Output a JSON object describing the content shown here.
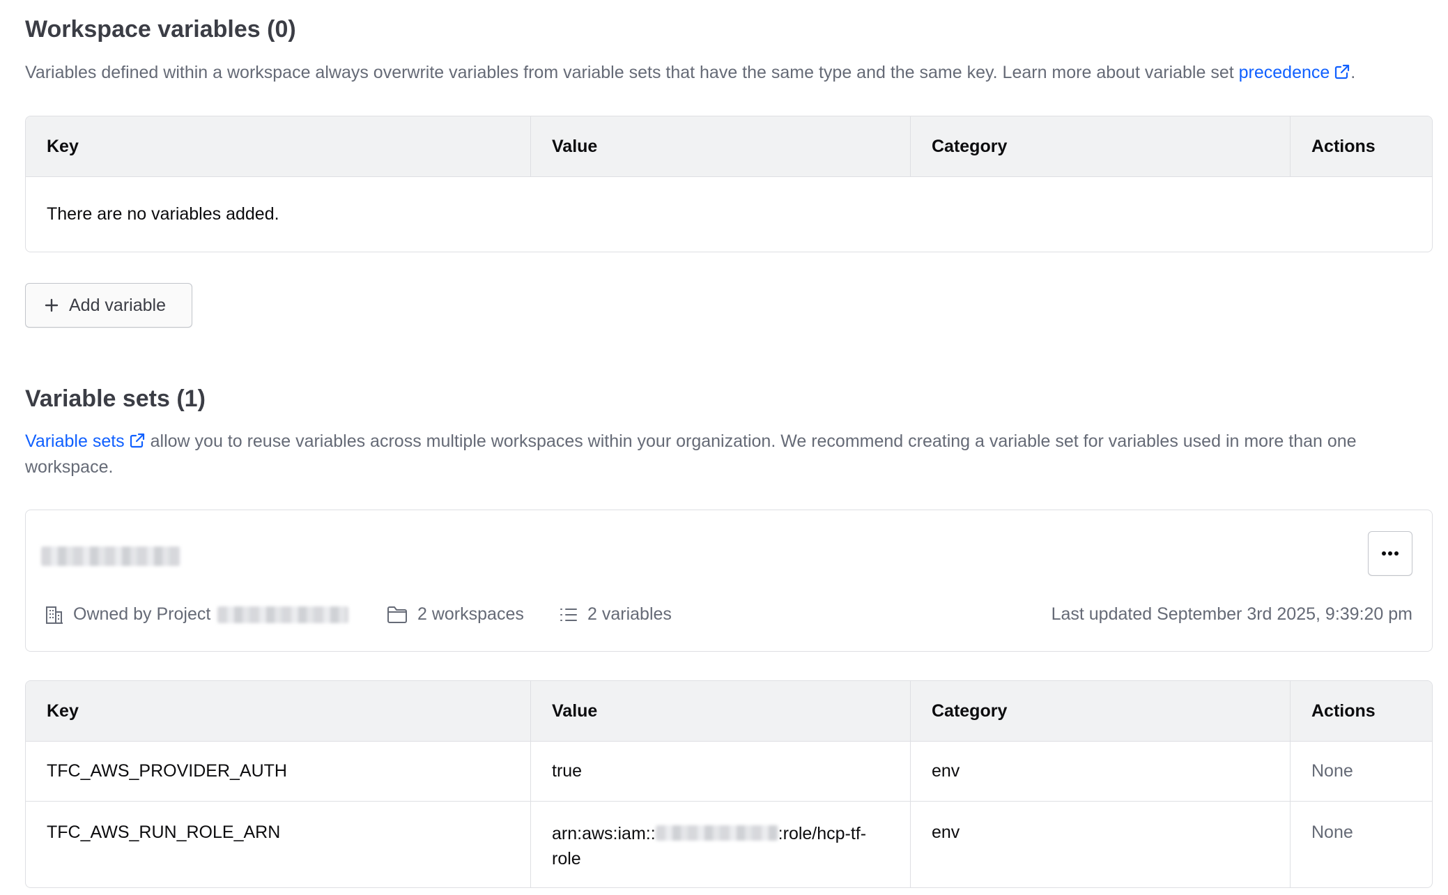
{
  "workspace_variables": {
    "title": "Workspace variables (0)",
    "description_prefix": "Variables defined within a workspace always overwrite variables from variable sets that have the same type and the same key. Learn more about variable set ",
    "precedence_link": "precedence",
    "description_suffix": ".",
    "table": {
      "headers": {
        "key": "Key",
        "value": "Value",
        "category": "Category",
        "actions": "Actions"
      },
      "empty_message": "There are no variables added."
    },
    "add_button_label": "Add variable"
  },
  "variable_sets": {
    "title": "Variable sets (1)",
    "link_text": "Variable sets",
    "description": " allow you to reuse variables across multiple workspaces within your organization. We recommend creating a variable set for variables used in more than one workspace.",
    "set": {
      "owned_by_label": "Owned by Project",
      "workspaces": "2 workspaces",
      "variables": "2 variables",
      "last_updated": "Last updated September 3rd 2025, 9:39:20 pm",
      "menu_label": "···"
    },
    "table": {
      "headers": {
        "key": "Key",
        "value": "Value",
        "category": "Category",
        "actions": "Actions"
      },
      "rows": [
        {
          "key": "TFC_AWS_PROVIDER_AUTH",
          "value": "true",
          "category": "env",
          "actions": "None"
        },
        {
          "key": "TFC_AWS_RUN_ROLE_ARN",
          "value_prefix": "arn:aws:iam::",
          "value_suffix": ":role/hcp-tf-",
          "value_line2": "role",
          "category": "env",
          "actions": "None"
        }
      ]
    }
  },
  "icons": {
    "external_link": "external-link-icon",
    "plus": "plus-icon",
    "building": "building-icon",
    "folder": "folder-icon",
    "list": "list-icon",
    "more": "more-horizontal-icon"
  },
  "colors": {
    "link": "#1060ff",
    "text": "#3b3d45",
    "muted": "#656a76",
    "border": "#dedfe3",
    "header_bg": "#f1f2f3"
  }
}
